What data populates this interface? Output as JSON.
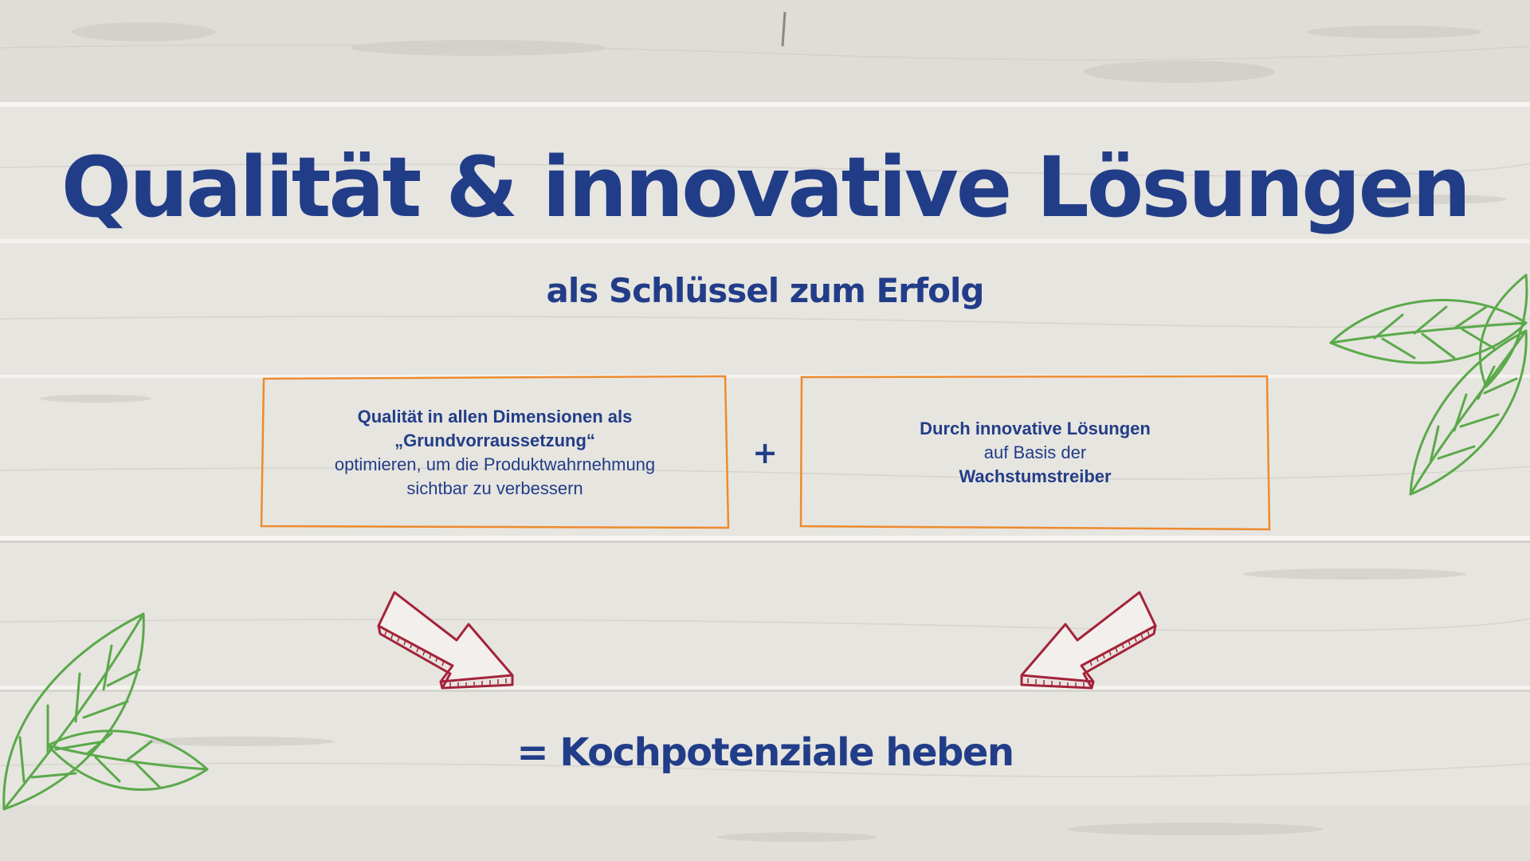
{
  "title": "Qualität & innovative Lösungen",
  "subtitle": "als Schlüssel zum Erfolg",
  "boxes": {
    "left": {
      "line1": "Qualität in allen Dimensionen als",
      "line2": "„Grundvorraussetzung“",
      "line3": "optimieren, um die Produktwahrnehmung",
      "line4": "sichtbar zu verbessern"
    },
    "right": {
      "line1": "Durch innovative Lösungen",
      "line2": "auf Basis der",
      "line3": "Wachstumstreiber"
    }
  },
  "plus": "+",
  "result": "= Kochpotenziale heben",
  "icons": {
    "arrow_left": "arrow-down-right-icon",
    "arrow_right": "arrow-down-left-icon",
    "leaf_top_right": "leaf-icon",
    "leaf_bottom_left": "leaf-icon"
  },
  "colors": {
    "text": "#223d88",
    "box_border": "#ee8a2e",
    "arrow": "#a4233a",
    "leaf": "#5aa94a",
    "background": "#e6e4df"
  }
}
